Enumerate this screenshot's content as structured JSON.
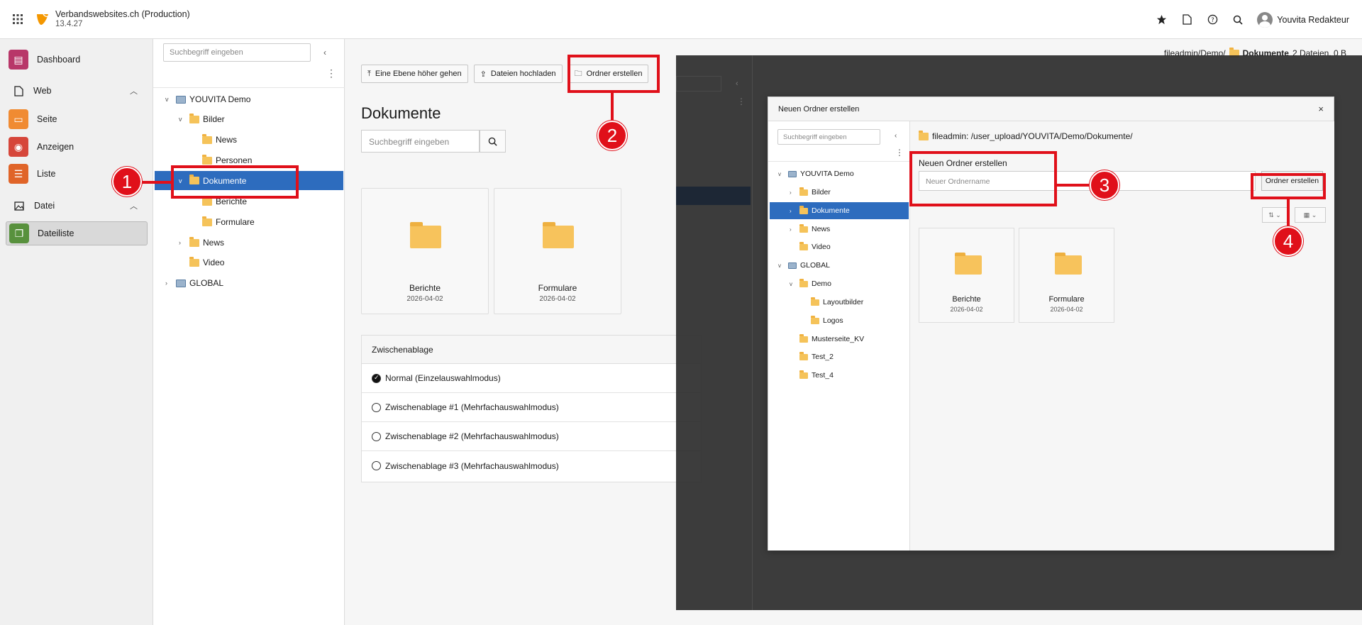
{
  "topbar": {
    "site_title": "Verbandswebsites.ch (Production)",
    "version": "13.4.27",
    "user_name": "Youvita Redakteur",
    "icons": [
      "apps-grid-icon",
      "bookmark-star-icon",
      "document-icon",
      "help-icon",
      "search-icon",
      "user-avatar-icon"
    ]
  },
  "modules": {
    "dashboard": "Dashboard",
    "web": "Web",
    "seite": "Seite",
    "anzeigen": "Anzeigen",
    "liste": "Liste",
    "datei": "Datei",
    "dateiliste": "Dateiliste"
  },
  "tree": {
    "search_placeholder": "Suchbegriff eingeben",
    "nodes": {
      "youvita": "YOUVITA Demo",
      "bilder": "Bilder",
      "bilder_news": "News",
      "personen": "Personen",
      "dokumente": "Dokumente",
      "berichte": "Berichte",
      "formulare": "Formulare",
      "news": "News",
      "video": "Video",
      "global": "GLOBAL"
    }
  },
  "main": {
    "breadcrumb_path": "fileadmin/Demo/",
    "breadcrumb_current": "Dokumente",
    "breadcrumb_info": "2 Dateien, 0 B",
    "toolbar": {
      "up": "Eine Ebene höher gehen",
      "upload": "Dateien hochladen",
      "new_folder": "Ordner erstellen"
    },
    "title": "Dokumente",
    "search_placeholder": "Suchbegriff eingeben",
    "cards": [
      {
        "name": "Berichte",
        "date": "2026-04-02"
      },
      {
        "name": "Formulare",
        "date": "2026-04-02"
      }
    ],
    "clipboard": {
      "header": "Zwischenablage",
      "options": [
        "Normal (Einzelauswahlmodus)",
        "Zwischenablage #1 (Mehrfachauswahlmodus)",
        "Zwischenablage #2 (Mehrfachauswahlmodus)",
        "Zwischenablage #3 (Mehrfachauswahlmodus)"
      ]
    }
  },
  "modal": {
    "title": "Neuen Ordner erstellen",
    "close": "×",
    "search_placeholder": "Suchbegriff eingeben",
    "tree": {
      "youvita": "YOUVITA Demo",
      "bilder": "Bilder",
      "dokumente": "Dokumente",
      "news": "News",
      "video": "Video",
      "global": "GLOBAL",
      "demo": "Demo",
      "layoutbilder": "Layoutbilder",
      "logos": "Logos",
      "musterseite": "Musterseite_KV",
      "test2": "Test_2",
      "test4": "Test_4"
    },
    "path": "fileadmin: /user_upload/YOUVITA/Demo/Dokumente/",
    "form_label": "Neuen Ordner erstellen",
    "input_placeholder": "Neuer Ordnername",
    "create_button": "Ordner erstellen",
    "cards": [
      {
        "name": "Berichte",
        "date": "2026-04-02"
      },
      {
        "name": "Formulare",
        "date": "2026-04-02"
      }
    ]
  },
  "annotations": {
    "m1": "1",
    "m2": "2",
    "m3": "3",
    "m4": "4"
  },
  "colors": {
    "accent": "#2d6cbe",
    "annotation": "#e0101a",
    "folder": "#f5c35a"
  }
}
